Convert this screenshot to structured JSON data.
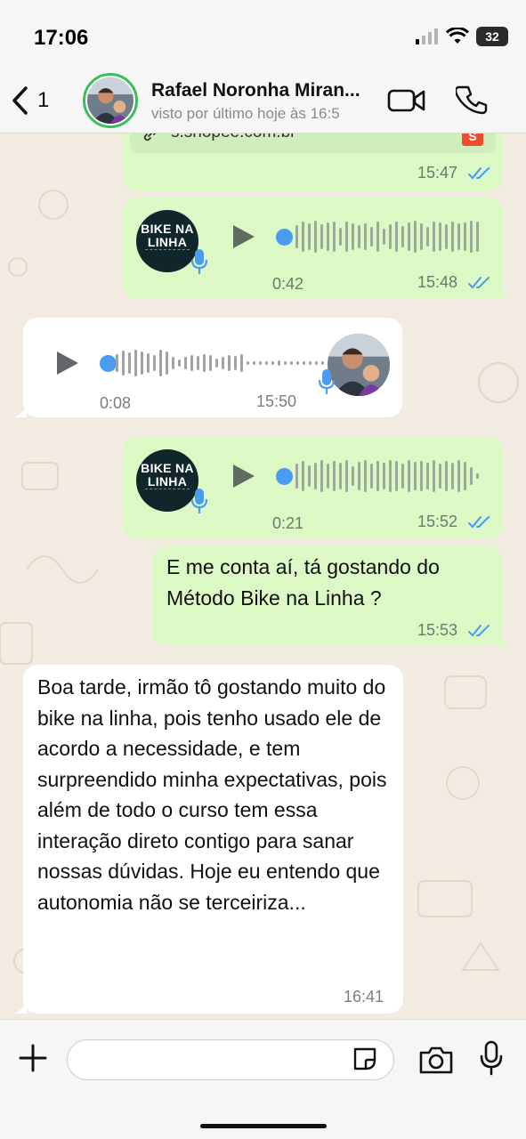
{
  "status_bar": {
    "time": "17:06",
    "battery": "32"
  },
  "header": {
    "back_count": "1",
    "contact_name": "Rafael Noronha Miran...",
    "contact_status": "visto por último hoje às 16:5"
  },
  "messages": [
    {
      "type": "link",
      "link_text": "s.shopee.com.br",
      "time": "15:47"
    },
    {
      "type": "audio",
      "thumb_title": "BIKE NA LINHA",
      "duration": "0:42",
      "time": "15:48"
    },
    {
      "type": "audio",
      "duration": "0:08",
      "time": "15:50"
    },
    {
      "type": "audio",
      "thumb_title": "BIKE NA LINHA",
      "duration": "0:21",
      "time": "15:52"
    },
    {
      "type": "text",
      "text": "E me conta aí, tá gostando do Método Bike na Linha ?",
      "time": "15:53"
    },
    {
      "type": "text",
      "text": "Boa tarde, irmão tô gostando muito do bike na linha, pois tenho usado ele de acordo a necessidade, e tem surpreendido minha expectativas, pois além de todo o curso tem essa interação direto contigo para sanar nossas dúvidas. Hoje eu entendo que autonomia não se terceiriza...",
      "time": "16:41"
    }
  ],
  "colors": {
    "outgoing": "#dbf8c5",
    "incoming": "#ffffff",
    "read_ticks": "#4a9cf0",
    "avatar_ring": "#3bbf5a"
  }
}
